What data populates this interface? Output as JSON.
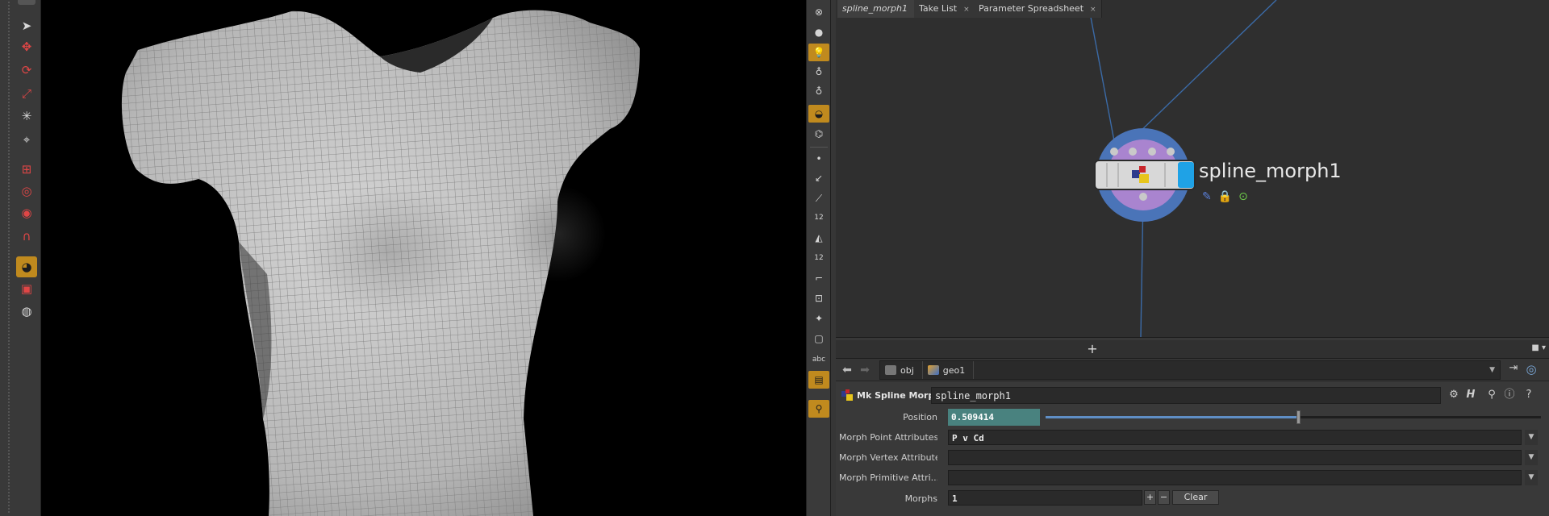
{
  "left_toolbar": {
    "tools": [
      {
        "icon": "select-arrow-icon"
      },
      {
        "icon": "transform-icon"
      },
      {
        "icon": "rotate-icon"
      },
      {
        "icon": "scale-icon"
      },
      {
        "icon": "pose-icon"
      },
      {
        "icon": "handle-icon"
      },
      {
        "icon": "edit-snap-icon"
      },
      {
        "icon": "edit-lasso-icon"
      },
      {
        "icon": "edit-brush-icon"
      },
      {
        "icon": "magnet-icon"
      },
      {
        "icon": "view-tool-icon"
      },
      {
        "icon": "render-region-icon"
      },
      {
        "icon": "camera-icon"
      }
    ]
  },
  "display_toolbar": {
    "buttons": [
      {
        "icon": "close-circle-icon"
      },
      {
        "icon": "sphere-shading-icon"
      },
      {
        "icon": "light-bulb-icon"
      },
      {
        "icon": "light-icon"
      },
      {
        "icon": "headlight-icon"
      },
      {
        "icon": "background-image-icon"
      },
      {
        "icon": "ghost-icon"
      },
      {
        "icon": "point-display-icon"
      },
      {
        "icon": "point-normal-icon"
      },
      {
        "icon": "vertex-icon"
      },
      {
        "icon": "point-number-icon",
        "label": "12"
      },
      {
        "icon": "brush-icon"
      },
      {
        "icon": "primitive-number-icon",
        "label": "12"
      },
      {
        "icon": "border-icon"
      },
      {
        "icon": "snap-grid-icon"
      },
      {
        "icon": "origin-icon"
      },
      {
        "icon": "frame-icon"
      },
      {
        "icon": "text-display-icon",
        "label": "abc"
      },
      {
        "icon": "image-icon"
      },
      {
        "icon": "bulb-toggle-icon"
      }
    ]
  },
  "network": {
    "node": {
      "name": "spline_morph1",
      "flags": [
        "paperclip-icon",
        "lock-icon",
        "display-check-icon"
      ],
      "colors": {
        "ring": "#4a74b8",
        "inner": "#a984cf",
        "accent": "#1fa2e6"
      }
    },
    "wire_color": "#3b6aa6"
  },
  "param_pane": {
    "tabs": [
      {
        "label": "spline_morph1",
        "close": "×"
      },
      {
        "label": "Take List",
        "close": "×"
      },
      {
        "label": "Parameter Spreadsheet",
        "close": "×"
      }
    ],
    "add_tab": "+",
    "path": {
      "segments": [
        "obj",
        "geo1"
      ]
    },
    "operator": {
      "type_label": "Mk Spline Morph",
      "name": "spline_morph1"
    },
    "parms": {
      "position": {
        "label": "Position",
        "value": "0.509414",
        "fraction": 0.509414
      },
      "morph_point_attributes": {
        "label": "Morph Point Attributes",
        "value": "P v Cd"
      },
      "morph_vertex_attributes": {
        "label": "Morph Vertex Attributes",
        "value": ""
      },
      "morph_primitive_attributes": {
        "label": "Morph Primitive Attri...",
        "value": ""
      },
      "morphs": {
        "label": "Morphs",
        "value": "1",
        "add": "+",
        "remove": "−",
        "clear": "Clear"
      }
    }
  }
}
